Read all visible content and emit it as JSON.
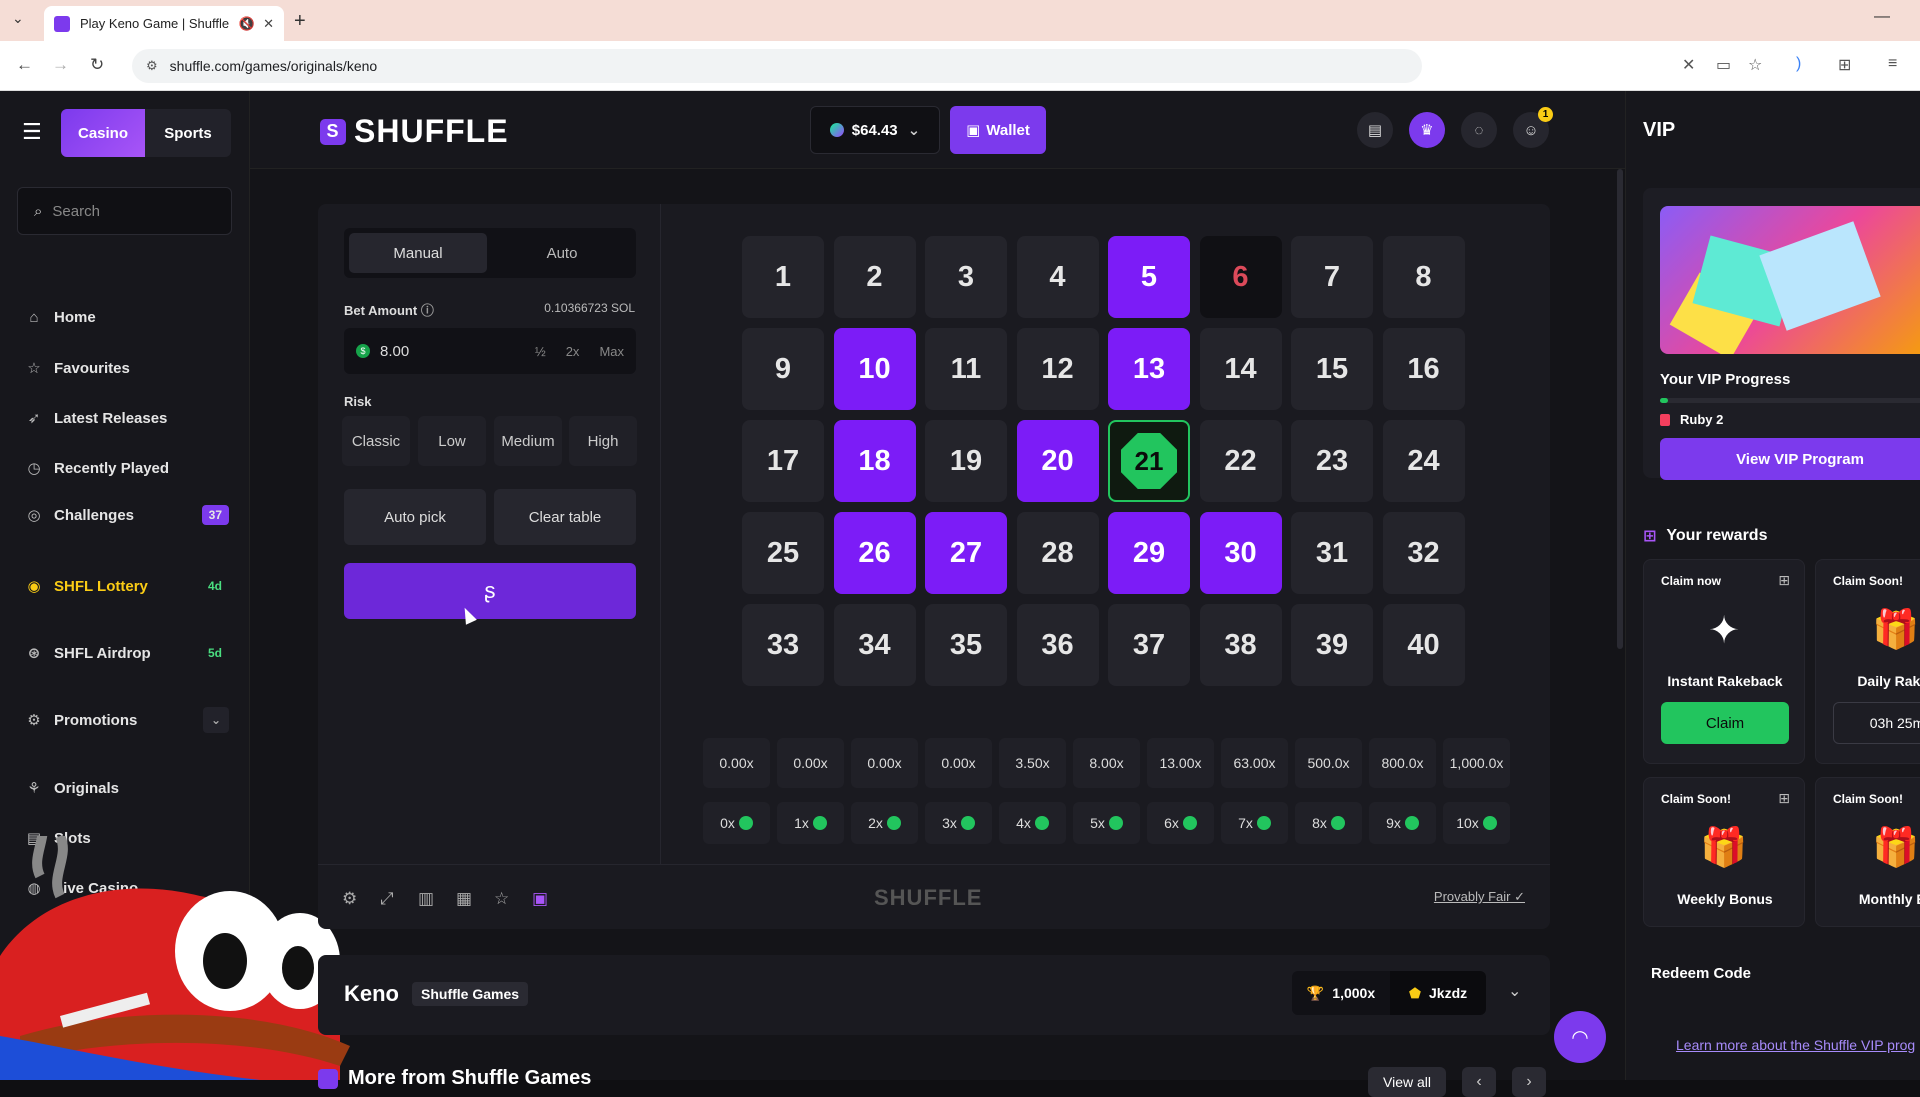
{
  "browser": {
    "tab_title": "Play Keno Game | Shuffle -",
    "url": "shuffle.com/games/originals/keno"
  },
  "sidebar": {
    "casino": "Casino",
    "sports": "Sports",
    "search_placeholder": "Search",
    "items": [
      {
        "label": "Home",
        "icon": "home-icon"
      },
      {
        "label": "Favourites",
        "icon": "star-icon"
      },
      {
        "label": "Latest Releases",
        "icon": "rocket-icon"
      },
      {
        "label": "Recently Played",
        "icon": "clock-icon"
      },
      {
        "label": "Challenges",
        "icon": "target-icon",
        "badge": "37"
      },
      {
        "label": "SHFL Lottery",
        "icon": "lottery-icon",
        "badge": "4d"
      },
      {
        "label": "SHFL Airdrop",
        "icon": "airdrop-icon",
        "badge": "5d"
      },
      {
        "label": "Promotions",
        "icon": "promo-icon"
      },
      {
        "label": "Originals",
        "icon": "originals-icon"
      },
      {
        "label": "Slots",
        "icon": "slots-icon"
      },
      {
        "label": "Live Casino",
        "icon": "live-icon"
      }
    ]
  },
  "header": {
    "logo": "SHUFFLE",
    "balance": "$64.43",
    "wallet": "Wallet",
    "notif_count": "1"
  },
  "controls": {
    "modes": [
      "Manual",
      "Auto"
    ],
    "bet_label": "Bet Amount",
    "bet_sol": "0.10366723 SOL",
    "bet_value": "8.00",
    "bet_mods": [
      "½",
      "2x",
      "Max"
    ],
    "risk_label": "Risk",
    "risk_options": [
      "Classic",
      "Low",
      "Medium",
      "High"
    ],
    "auto_pick": "Auto pick",
    "clear_table": "Clear table",
    "bet_icon": "shuffle-logo-icon"
  },
  "board": {
    "numbers": [
      "1",
      "2",
      "3",
      "4",
      "5",
      "6",
      "7",
      "8",
      "9",
      "10",
      "11",
      "12",
      "13",
      "14",
      "15",
      "16",
      "17",
      "18",
      "19",
      "20",
      "21",
      "22",
      "23",
      "24",
      "25",
      "26",
      "27",
      "28",
      "29",
      "30",
      "31",
      "32",
      "33",
      "34",
      "35",
      "36",
      "37",
      "38",
      "39",
      "40"
    ],
    "selected": [
      "5",
      "10",
      "13",
      "18",
      "20",
      "26",
      "27",
      "29",
      "30"
    ],
    "missed": [
      "6"
    ],
    "hit": [
      "21"
    ],
    "multipliers": [
      "0.00x",
      "0.00x",
      "0.00x",
      "0.00x",
      "3.50x",
      "8.00x",
      "13.00x",
      "63.00x",
      "500.0x",
      "800.0x",
      "1,000.0x"
    ],
    "hit_counts": [
      "0x",
      "1x",
      "2x",
      "3x",
      "4x",
      "5x",
      "6x",
      "7x",
      "8x",
      "9x",
      "10x"
    ]
  },
  "game_footer": {
    "logo": "SHUFFLE",
    "provably_fair": "Provably Fair"
  },
  "info": {
    "name": "Keno",
    "provider": "Shuffle Games",
    "max_win": "1,000x",
    "top_user": "Jkzdz",
    "more_title": "More from Shuffle Games",
    "view_all": "View all"
  },
  "vip": {
    "title": "VIP",
    "progress_label": "Your VIP Progress",
    "progress_fraction": 0.03,
    "rank": "Ruby 2",
    "view_program": "View VIP Program",
    "rewards_title": "Your rewards",
    "rewards": [
      {
        "head": "Claim now",
        "name": "Instant Rakeback",
        "action": "Claim"
      },
      {
        "head": "Claim Soon!",
        "name": "Daily Rakeb",
        "action": "03h 25m"
      },
      {
        "head": "Claim Soon!",
        "name": "Weekly Bonus"
      },
      {
        "head": "Claim Soon!",
        "name": "Monthly Bo"
      }
    ],
    "redeem": "Redeem Code",
    "learn_more": "Learn more about the Shuffle VIP prog"
  }
}
